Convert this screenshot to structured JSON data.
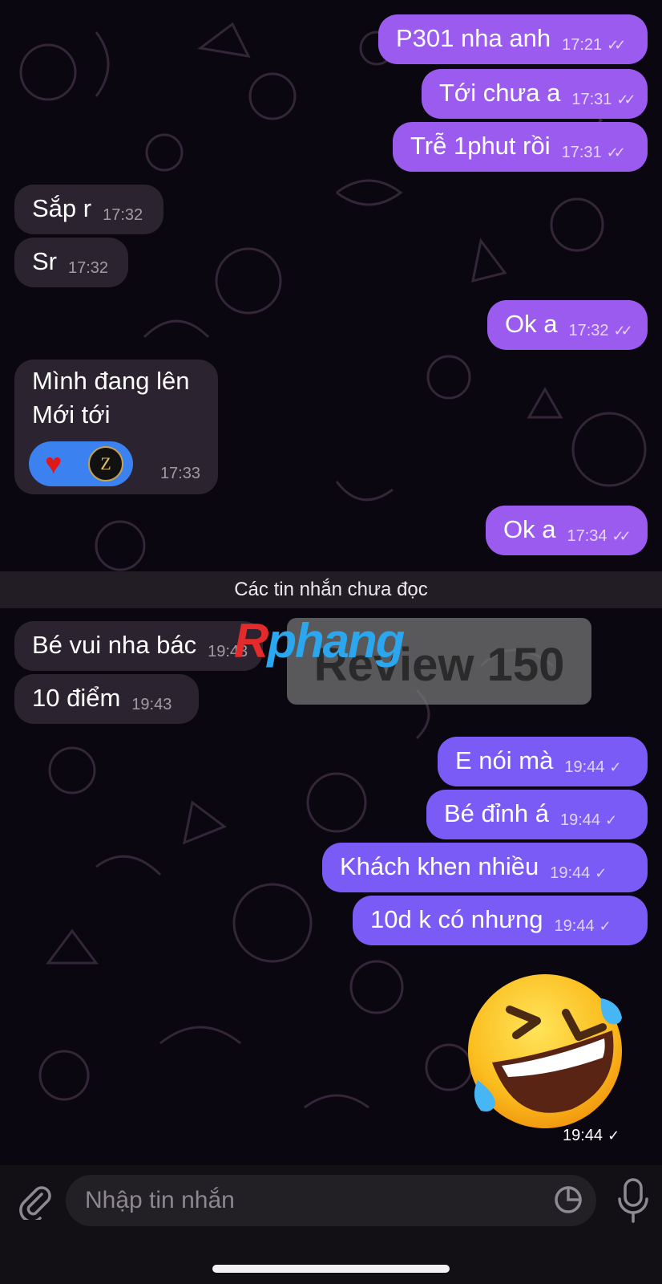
{
  "messages": {
    "m1": {
      "text": "P301 nha anh",
      "time": "17:21"
    },
    "m2": {
      "text": "Tới chưa a",
      "time": "17:31"
    },
    "m3": {
      "text": "Trễ 1phut rồi",
      "time": "17:31"
    },
    "m4": {
      "text": "Sắp r",
      "time": "17:32"
    },
    "m5": {
      "text": "Sr",
      "time": "17:32"
    },
    "m6": {
      "text": "Ok a",
      "time": "17:32"
    },
    "m7": {
      "line1": "Mình đang lên",
      "line2": "Mới tới",
      "time": "17:33"
    },
    "m8": {
      "text": "Ok a",
      "time": "17:34"
    },
    "m9": {
      "text": "Bé vui nha bác",
      "time": "19:43"
    },
    "m10": {
      "text": "10 điểm",
      "time": "19:43"
    },
    "m11": {
      "text": "E nói mà",
      "time": "19:44"
    },
    "m12": {
      "text": "Bé đỉnh á",
      "time": "19:44"
    },
    "m13": {
      "text": "Khách khen nhiều",
      "time": "19:44"
    },
    "m14": {
      "text": "10d k có nhưng",
      "time": "19:44"
    },
    "sticker_time": "19:44"
  },
  "reaction_badge_letter": "Z",
  "unread_divider": "Các tin nhắn chưa đọc",
  "watermark": {
    "logo_r": "R",
    "logo_rest": "phang",
    "text": "Review 150"
  },
  "composer": {
    "placeholder": "Nhập tin nhắn"
  },
  "colors": {
    "background": "#0a0710",
    "incoming_bubble": "#2b2330",
    "outgoing_bubble_read": "#9b5bef",
    "outgoing_bubble_sent": "#7a5bf5"
  },
  "icons": [
    "attach-icon",
    "sticker-icon",
    "mic-icon",
    "heart-icon",
    "double-check-icon",
    "single-check-icon"
  ]
}
